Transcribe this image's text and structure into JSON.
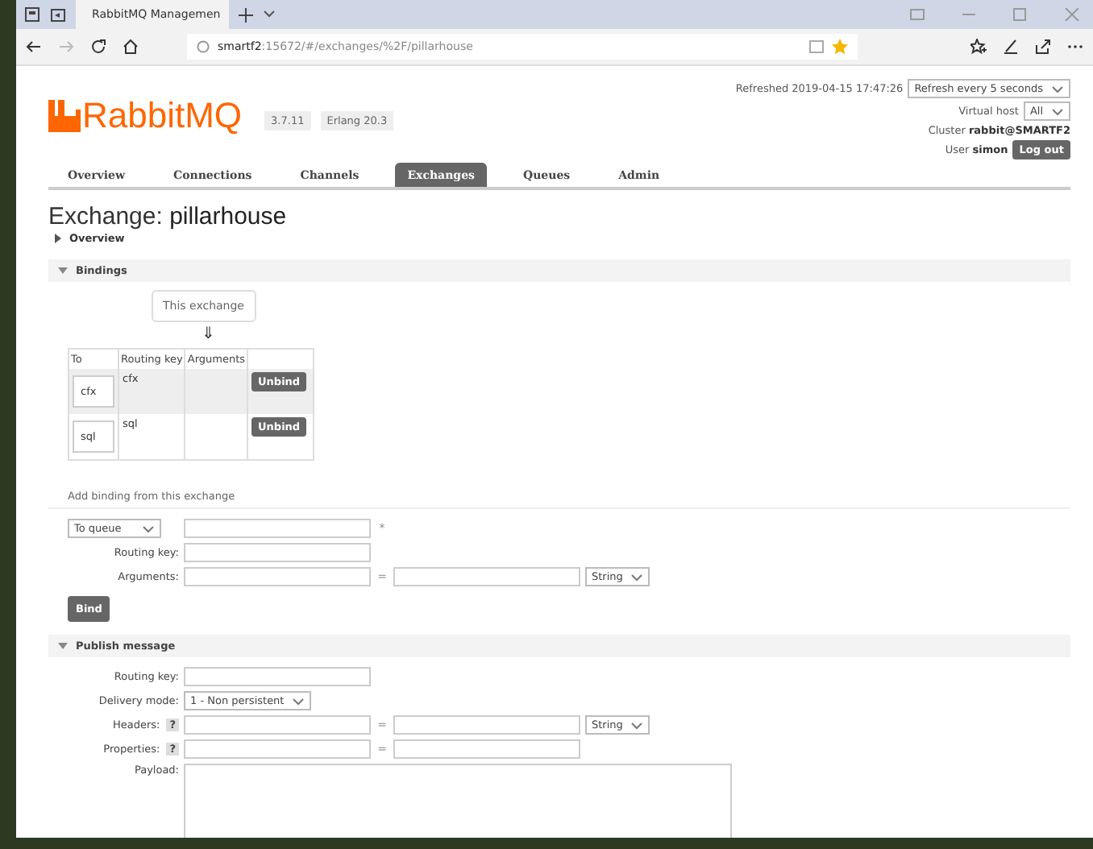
{
  "browser": {
    "tab_title": "RabbitMQ Managemen",
    "url": "**smartf2**:15672/#/exchanges/%2F/pillarhouse"
  },
  "header": {
    "logo": "RabbitMQ",
    "badges": [
      "3.7.11",
      "Erlang 20.3"
    ],
    "refreshed": "Refreshed 2019-04-15 17:47:26",
    "refresh_select": "Refresh every 5 seconds",
    "vhost_label": "Virtual host",
    "vhost_select": "All",
    "cluster": "Cluster **rabbit@SMARTF2**",
    "user": "User **simon**",
    "logout": "Log out"
  },
  "tabs": [
    {
      "label": "Overview",
      "selected": false
    },
    {
      "label": "Connections",
      "selected": false
    },
    {
      "label": "Channels",
      "selected": false
    },
    {
      "label": "Exchanges",
      "selected": true
    },
    {
      "label": "Queues",
      "selected": false
    },
    {
      "label": "Admin",
      "selected": false
    }
  ],
  "title": "Exchange: **pillarhouse**",
  "overview": {
    "label": "Overview",
    "expanded": false
  },
  "bindings": {
    "label": "Bindings",
    "expanded": true,
    "source": "This exchange",
    "arrow": "⇓",
    "columns": [
      "To",
      "Routing key",
      "Arguments"
    ],
    "rows": [
      {
        "to": "cfx",
        "routing_key": "cfx",
        "action": "Unbind"
      },
      {
        "to": "sql",
        "routing_key": "sql",
        "action": "Unbind"
      }
    ]
  },
  "add_binding": {
    "heading": "Add binding from this exchange",
    "destination": "To queue",
    "required": "*",
    "routing_key_label": "Routing key:",
    "arguments_label": "Arguments:",
    "equals": "=",
    "type": "String",
    "button": "Bind"
  },
  "publish": {
    "label": "Publish message",
    "expanded": true,
    "routing_key_label": "Routing key:",
    "delivery_label": "Delivery mode:",
    "delivery": "1 - Non persistent",
    "headers_label": "Headers:",
    "properties_label": "Properties:",
    "help": "?",
    "equals": "=",
    "type": "String",
    "payload_label": "Payload:"
  }
}
